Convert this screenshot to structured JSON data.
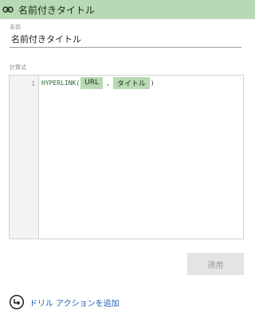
{
  "header": {
    "icon": "link-icon",
    "title": "名前付きタイトル"
  },
  "name_field": {
    "label": "名前",
    "value": "名前付きタイトル"
  },
  "formula": {
    "label": "計算式",
    "line_number": "1",
    "function_name": "HYPERLINK(",
    "arg1": "URL",
    "separator": ",",
    "arg2": "タイトル",
    "close": ")"
  },
  "apply_button": {
    "label": "適用"
  },
  "drill_action": {
    "icon": "drill-arrow-icon",
    "label": "ドリル アクションを追加"
  },
  "colors": {
    "accent_green": "#b7d9b3",
    "link_blue": "#1a5fb4",
    "disabled_gray": "#e4e4e4"
  }
}
